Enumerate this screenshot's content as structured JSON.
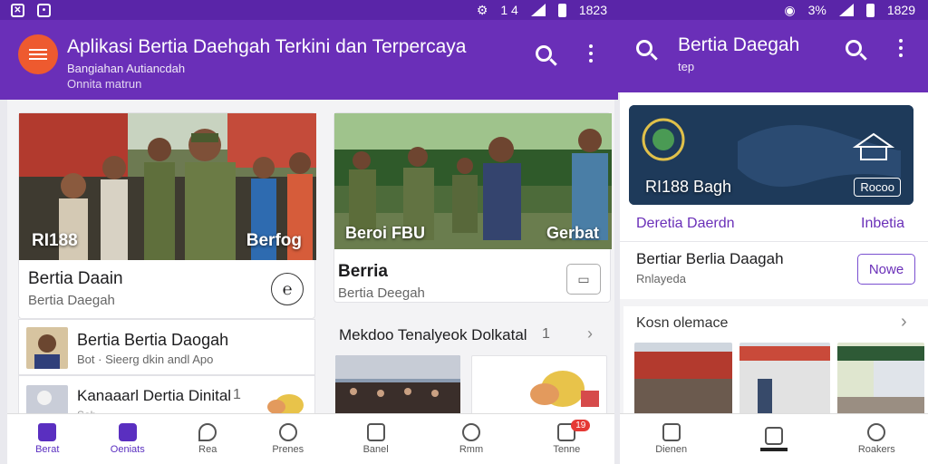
{
  "status_left": {
    "time": "1823",
    "icons": [
      "close-icon",
      "android-icon"
    ],
    "signals": "1 4"
  },
  "status_right": {
    "signal": "3%",
    "time": "1829"
  },
  "left_app": {
    "title": "Aplikasi Bertia Daehgah Terkini dan Terpercaya",
    "subtitle": "Bangiahan Autiancdah",
    "subtitle2": "Onnita matrun"
  },
  "right_app": {
    "title": "Bertia Daegah",
    "subtitle": "tep"
  },
  "panel1": {
    "hero_left_caption": "RI188",
    "hero_right_caption": "Berfog",
    "card_title": "Bertia Daain",
    "card_subtitle": "Bertia Daegah",
    "row1_title": "Bertia Bertia Daogah",
    "row1_meta": "Bot ·  Sieerg  dkin andl  Apo",
    "row2_title": "Kanaaarl Dertia Dinital",
    "row2_count": "1",
    "row2_meta": "Sab"
  },
  "panel2": {
    "hero_left_caption": "Beroi FBU",
    "hero_right_caption": "Gerbat",
    "card_title": "Berria",
    "card_subtitle": "Bertia Deegah",
    "section_title": "Mekdoo Tenalyeok Dolkatal",
    "section_count": "1"
  },
  "panel3": {
    "banner_caption": "RI188 Bagh",
    "banner_badge": "Rocoo",
    "link_left": "Deretia Daerdn",
    "link_right": "Inbetia",
    "story_title": "Bertiar Berlia Daagah",
    "story_meta": "Rnlayeda",
    "story_button": "Nowe",
    "section_title": "Kosn olemace",
    "thumb_captions": [
      "",
      "",
      ""
    ]
  },
  "nav_left": [
    {
      "label": "Berat",
      "icon": "home-icon",
      "active": true
    },
    {
      "label": "Oeniats",
      "icon": "grid-icon",
      "active": true
    },
    {
      "label": "Rea",
      "icon": "pen-icon",
      "active": false
    },
    {
      "label": "Prenes",
      "icon": "person-icon",
      "active": false
    }
  ],
  "nav_mid": [
    {
      "label": "Banel",
      "icon": "home-icon"
    },
    {
      "label": "Rmm",
      "icon": "fire-icon"
    },
    {
      "label": "Tenne",
      "icon": "bell-icon",
      "badge": "19"
    }
  ],
  "nav_right": [
    {
      "label": "Dienen",
      "icon": "home-icon"
    },
    {
      "label": "",
      "icon": "bookmark-icon"
    },
    {
      "label": "Roakers",
      "icon": "heart-icon"
    }
  ],
  "colors": {
    "purple": "#6a2fb8",
    "status": "#5a25a8",
    "accent": "#ee5a2f",
    "link": "#6a2fb8"
  }
}
